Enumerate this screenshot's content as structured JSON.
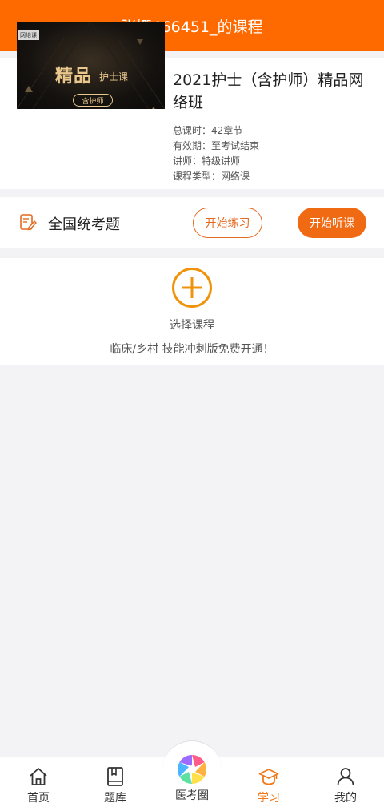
{
  "header": {
    "title": "张娜466451_的课程"
  },
  "course": {
    "thumbnail": {
      "tag": "网络课",
      "headline": "精品",
      "subheadline": "护士课",
      "pill": "含护师"
    },
    "title": "2021护士（含护师）精品网络班",
    "meta": {
      "total_lessons": "总课时：42章节",
      "validity": "有效期：至考试结束",
      "lecturer": "讲师：特级讲师",
      "course_type": "课程类型：网络课"
    }
  },
  "exam": {
    "label": "全国统考题",
    "practice_button": "开始练习",
    "listen_button": "开始听课"
  },
  "select_course": {
    "label": "选择课程",
    "promo": "临床/乡村 技能冲刺版免费开通！"
  },
  "tab_bar": {
    "active": "学习",
    "items": [
      {
        "label": "首页",
        "icon": "home-icon"
      },
      {
        "label": "题库",
        "icon": "book-icon"
      },
      {
        "label": "医考圈",
        "icon": "shutter-icon"
      },
      {
        "label": "学习",
        "icon": "graduation-cap-icon"
      },
      {
        "label": "我的",
        "icon": "person-icon"
      }
    ]
  },
  "colors": {
    "brand_orange": "#ff6a00",
    "button_orange": "#f06a14",
    "active_tab": "#f07a1a"
  }
}
